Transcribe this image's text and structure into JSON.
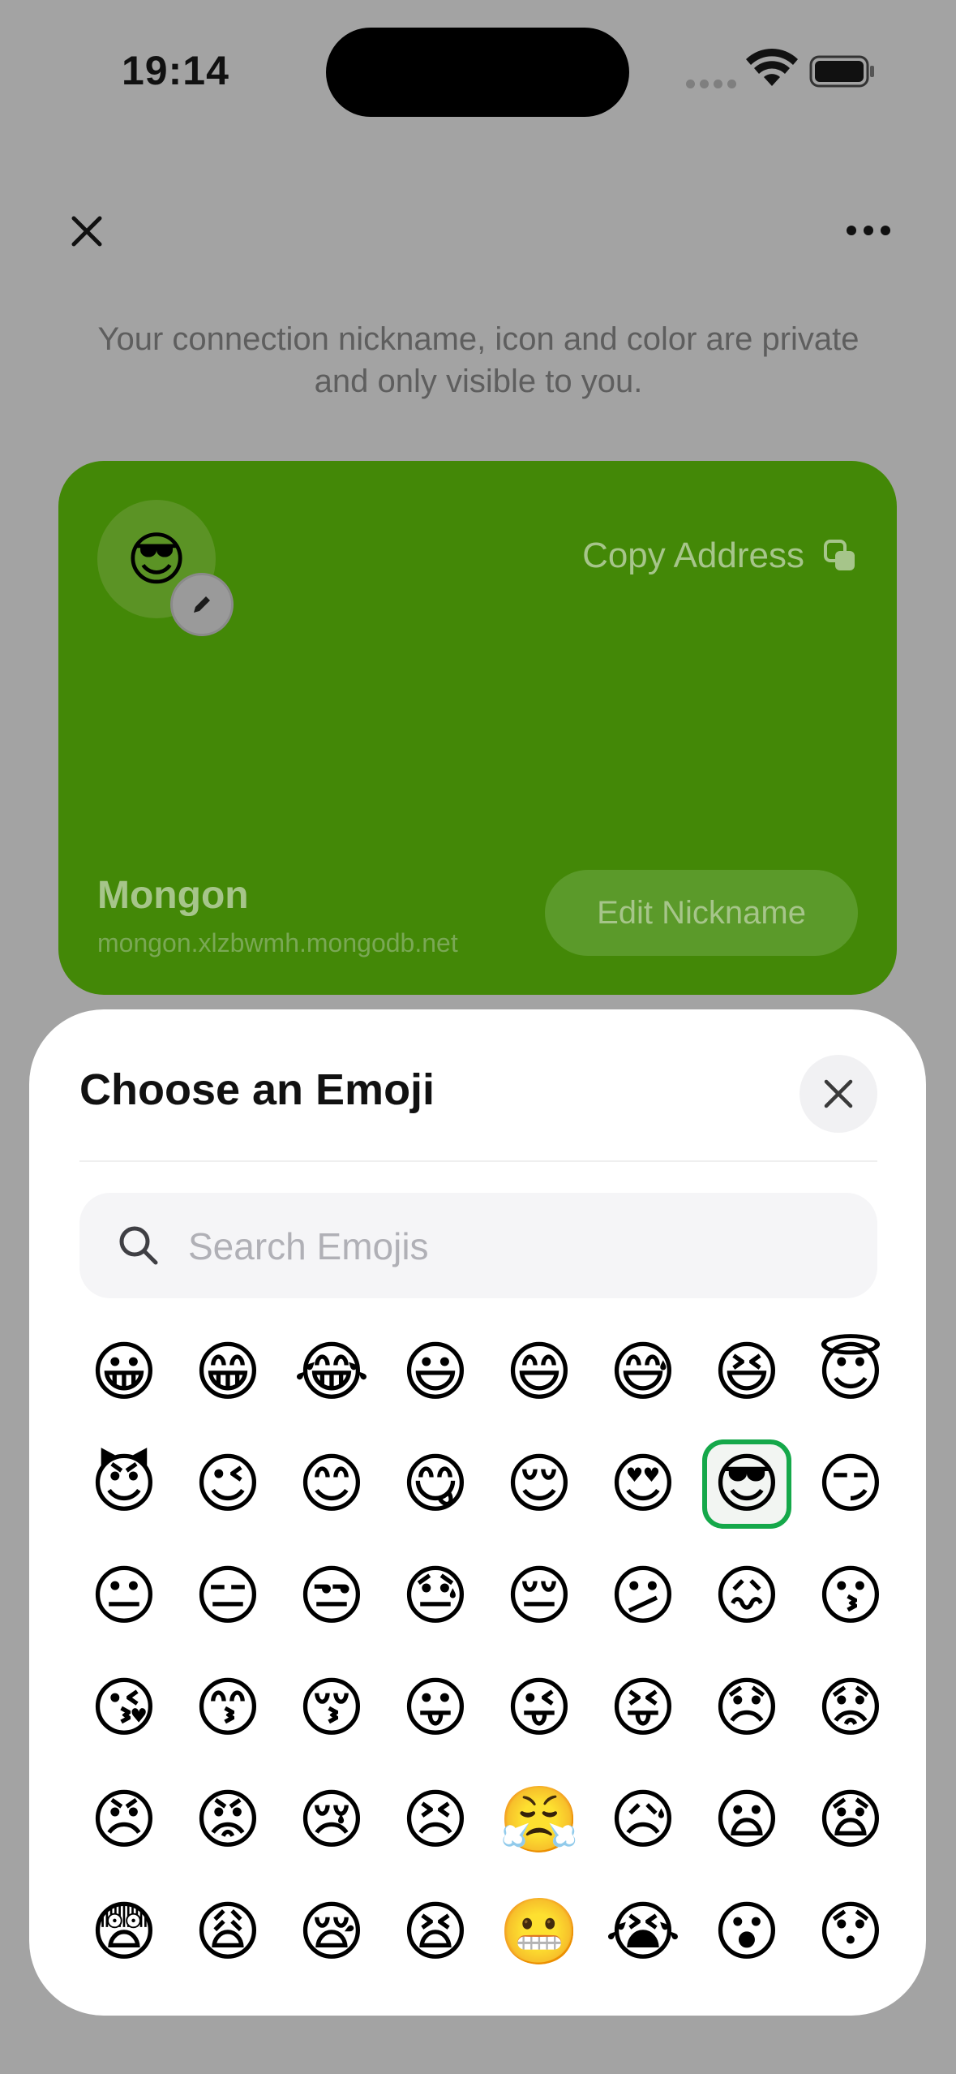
{
  "status_bar": {
    "time": "19:14"
  },
  "header": {
    "privacy_note": "Your connection nickname, icon and color are private and only visible to you."
  },
  "card": {
    "color": "#438807",
    "avatar_emoji": "😎",
    "copy_address_label": "Copy Address",
    "name": "Mongon",
    "host": "mongon.xlzbwmh.mongodb.net",
    "edit_nickname_label": "Edit Nickname"
  },
  "emoji_sheet": {
    "title": "Choose an Emoji",
    "search_placeholder": "Search Emojis",
    "search_value": "",
    "selected_emoji": "😎",
    "emojis": [
      "😀",
      "😁",
      "😂",
      "😃",
      "😄",
      "😅",
      "😆",
      "😇",
      "😈",
      "😉",
      "😊",
      "😋",
      "😌",
      "😍",
      "😎",
      "😏",
      "😐",
      "😑",
      "😒",
      "😓",
      "😔",
      "😕",
      "😖",
      "😗",
      "😘",
      "😙",
      "😚",
      "😛",
      "😜",
      "😝",
      "😞",
      "😟",
      "😠",
      "😡",
      "😢",
      "😣",
      "😤",
      "😥",
      "😦",
      "😧",
      "😨",
      "😩",
      "😪",
      "😫",
      "😬",
      "😭",
      "😮",
      "😯"
    ]
  }
}
